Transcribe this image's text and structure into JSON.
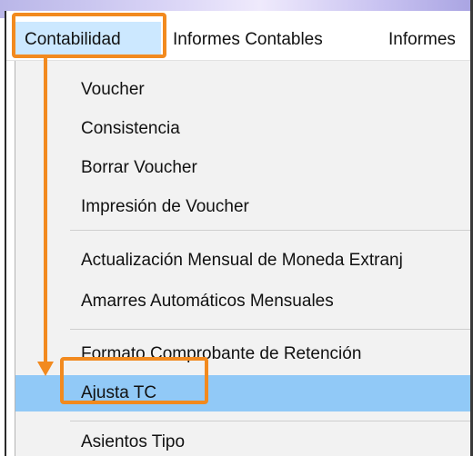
{
  "menubar": {
    "items": [
      {
        "label": "Contabilidad"
      },
      {
        "label": "Informes Contables"
      },
      {
        "label": "Informes"
      }
    ]
  },
  "dropdown": {
    "groups": [
      [
        "Voucher",
        "Consistencia",
        "Borrar Voucher",
        "Impresión de Voucher"
      ],
      [
        "Actualización Mensual de Moneda Extranj",
        "Amarres Automáticos Mensuales"
      ],
      [
        "Formato Comprobante de Retención",
        "Ajusta TC"
      ],
      [
        "Asientos Tipo"
      ]
    ],
    "highlighted": "Ajusta TC"
  },
  "annotation": {
    "color": "#f28a1f",
    "highlight_color": "#91c9f7"
  }
}
